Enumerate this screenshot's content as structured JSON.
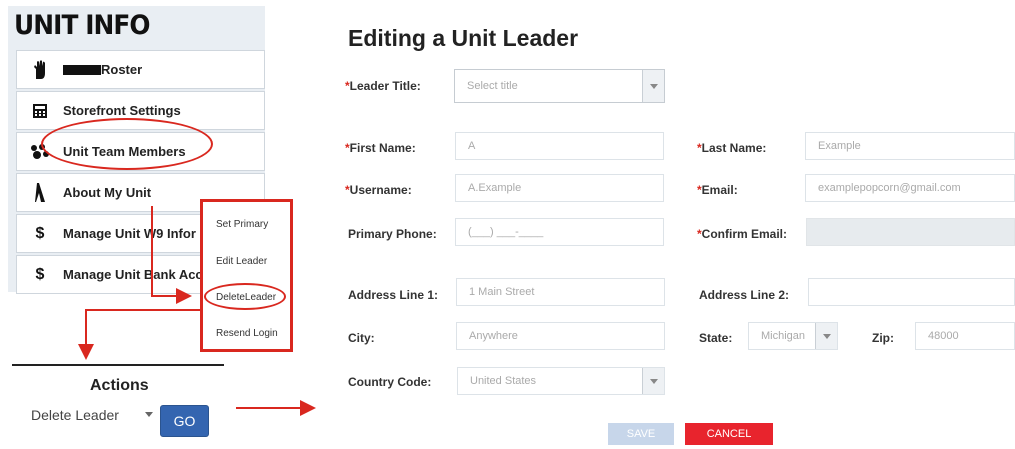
{
  "sidebar": {
    "title": "UNIT INFO",
    "items": [
      {
        "label": "Roster",
        "icon": "hand-icon"
      },
      {
        "label": "Storefront Settings",
        "icon": "calculator-icon"
      },
      {
        "label": "Unit Team Members",
        "icon": "team-icon"
      },
      {
        "label": "About My Unit",
        "icon": "info-icon"
      },
      {
        "label": "Manage Unit W9 Infor",
        "icon": "dollar-icon"
      },
      {
        "label": "Manage Unit Bank Acc",
        "icon": "dollar-icon"
      }
    ]
  },
  "action_menu": {
    "items": [
      "Set Primary",
      "Edit Leader",
      "DeleteLeader",
      "Resend Login"
    ]
  },
  "actions": {
    "title": "Actions",
    "selected": "Delete Leader",
    "go_label": "GO"
  },
  "form": {
    "title": "Editing a Unit Leader",
    "leader_title": {
      "label": "Leader Title:",
      "value": "Select title"
    },
    "first_name": {
      "label": "First Name:",
      "value": "A"
    },
    "last_name": {
      "label": "Last Name:",
      "value": "Example"
    },
    "username": {
      "label": "Username:",
      "value": "A.Example"
    },
    "email": {
      "label": "Email:",
      "value": "examplepopcorn@gmail.com"
    },
    "primary_phone": {
      "label": "Primary Phone:",
      "value": "(___) ___-____"
    },
    "confirm_email": {
      "label": "Confirm Email:",
      "value": ""
    },
    "address1": {
      "label": "Address Line 1:",
      "value": "1 Main Street"
    },
    "address2": {
      "label": "Address Line 2:",
      "value": ""
    },
    "city": {
      "label": "City:",
      "value": "Anywhere"
    },
    "state": {
      "label": "State:",
      "value": "Michigan"
    },
    "zip": {
      "label": "Zip:",
      "value": "48000"
    },
    "country_code": {
      "label": "Country Code:",
      "value": "United States"
    },
    "save_label": "SAVE",
    "cancel_label": "CANCEL"
  },
  "colors": {
    "highlight": "#d9281f",
    "go_button": "#3465b0",
    "cancel_button": "#e8242d",
    "save_button": "#c7d6ea",
    "sidebar_bg": "#e9eef3"
  }
}
